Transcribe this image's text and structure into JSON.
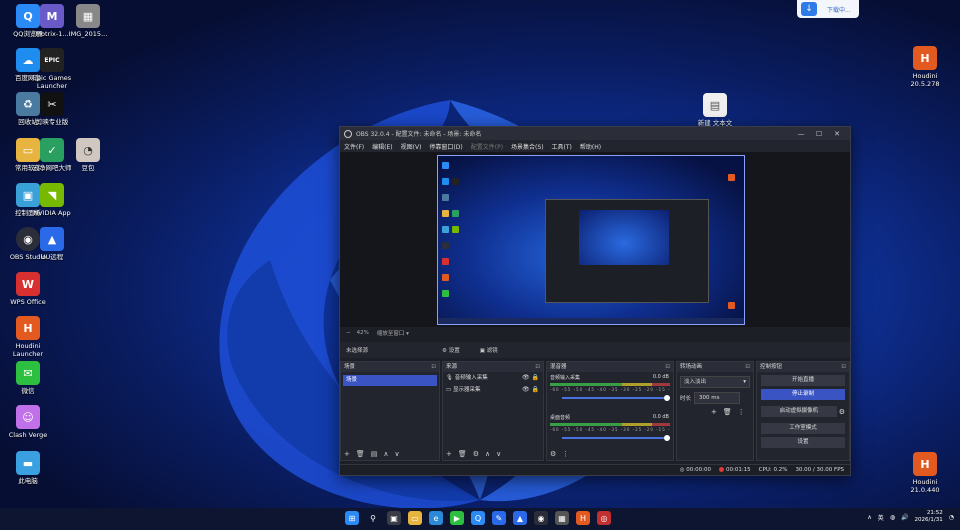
{
  "desktop": {
    "icons": [
      {
        "label": "QQ浏览器",
        "glyph": "Q",
        "color": "#2a8af6"
      },
      {
        "label": "百度网盘",
        "glyph": "☁",
        "color": "#1f8df0"
      },
      {
        "label": "回收站",
        "glyph": "♻",
        "color": "#4a7aa0"
      },
      {
        "label": "常用软件",
        "glyph": "▭",
        "color": "#e8b440"
      },
      {
        "label": "控制面板",
        "glyph": "▣",
        "color": "#3aa0d8"
      },
      {
        "label": "OBS Studio",
        "glyph": "◉",
        "color": "#2b2e38"
      },
      {
        "label": "WPS Office",
        "glyph": "W",
        "color": "#d83030"
      },
      {
        "label": "Houdini Launcher",
        "glyph": "H",
        "color": "#e35a20"
      },
      {
        "label": "微信",
        "glyph": "✉",
        "color": "#2dc040"
      },
      {
        "label": "Clash Verge",
        "glyph": "☺",
        "color": "#c070e8"
      },
      {
        "label": "此电脑",
        "glyph": "▬",
        "color": "#3aa0e0"
      },
      {
        "label": "Motrix-1...",
        "glyph": "M",
        "color": "#6a5ac8"
      },
      {
        "label": "Epic Games Launcher",
        "glyph": "EPIC",
        "color": "#222222"
      },
      {
        "label": "剪映专业版",
        "glyph": "✂",
        "color": "#111111"
      },
      {
        "label": "云净网吧大师",
        "glyph": "✓",
        "color": "#2aa060"
      },
      {
        "label": "NVIDIA App",
        "glyph": "◥",
        "color": "#76b900"
      },
      {
        "label": "UU远程",
        "glyph": "▲",
        "color": "#2a6ae8"
      },
      {
        "label": "IMG_2015...",
        "glyph": "▦",
        "color": "#888888"
      },
      {
        "label": "豆包",
        "glyph": "◔",
        "color": "#d0c8c0"
      },
      {
        "label": "Houdini 20.5.278",
        "glyph": "H",
        "color": "#e35a20"
      },
      {
        "label": "新建 文本文",
        "glyph": "▤",
        "color": "#f0f0f0"
      },
      {
        "label": "Houdini 21.0.440",
        "glyph": "H",
        "color": "#e35a20"
      }
    ]
  },
  "toast": {
    "label": "下载中..."
  },
  "obs": {
    "title": "OBS 32.0.4 - 配置文件: 未命名 - 场景: 未命名",
    "menu": [
      "文件(F)",
      "编辑(E)",
      "视图(V)",
      "停靠窗口(D)",
      "配置文件(P)",
      "场景集合(S)",
      "工具(T)",
      "帮助(H)"
    ],
    "zoom": "42%",
    "zoom_mode": "缩放至窗口",
    "no_source": "未选择源",
    "properties": "⚙ 设置",
    "filters": "▣ 滤镜",
    "scenes_title": "场景",
    "scene_item": "场景",
    "sources_title": "来源",
    "sources": [
      "音频输入采集",
      "显示器采集"
    ],
    "mixer_title": "混音器",
    "mixer": [
      {
        "name": "音频输入采集",
        "db": "0.0 dB"
      },
      {
        "name": "桌面音频",
        "db": "0.0 dB"
      }
    ],
    "scale": "-60 -55 -50 -45 -40 -35 -30 -25 -20 -15 -10 -5 0",
    "transitions_title": "转场动画",
    "transition": "淡入淡出",
    "duration_label": "时长",
    "duration": "300 ms",
    "controls_title": "控制按钮",
    "controls": [
      "开始直播",
      "停止录制",
      "启动虚拟摄像机",
      "工作室模式",
      "设置"
    ],
    "status": {
      "stream": "00:00:00",
      "rec": "00:01:15",
      "cpu": "CPU: 0.2%",
      "fps": "30.00 / 30.00 FPS"
    }
  },
  "taskbar": {
    "apps": [
      {
        "glyph": "⊞",
        "color": "#2a8af6"
      },
      {
        "glyph": "⚲",
        "color": "#0d1530"
      },
      {
        "glyph": "▣",
        "color": "#3a3d48"
      },
      {
        "glyph": "▭",
        "color": "#e8b440"
      },
      {
        "glyph": "e",
        "color": "#2a8ad8"
      },
      {
        "glyph": "▶",
        "color": "#2dc040"
      },
      {
        "glyph": "Q",
        "color": "#2a8af6"
      },
      {
        "glyph": "✎",
        "color": "#2a6ae8"
      },
      {
        "glyph": "▲",
        "color": "#2a6ae8"
      },
      {
        "glyph": "◉",
        "color": "#2b2e38"
      },
      {
        "glyph": "▦",
        "color": "#555555"
      },
      {
        "glyph": "H",
        "color": "#e35a20"
      },
      {
        "glyph": "◎",
        "color": "#c03030"
      }
    ],
    "lang": "英",
    "time": "21:52",
    "date": "2026/1/31"
  }
}
